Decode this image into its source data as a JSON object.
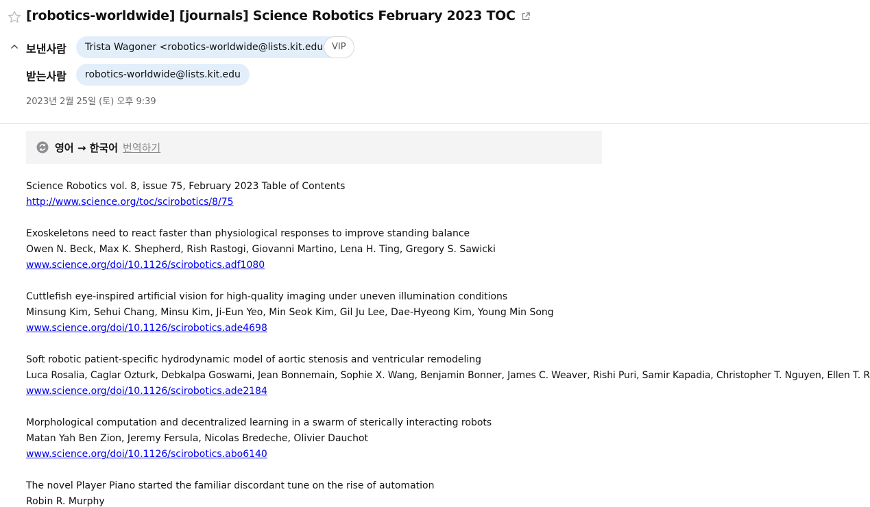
{
  "header": {
    "subject": "[robotics-worldwide] [journals] Science Robotics February 2023 TOC",
    "from_label": "보낸사람",
    "from_value": "Trista Wagoner <robotics-worldwide@lists.kit.edu>",
    "vip_label": "VIP",
    "to_label": "받는사람",
    "to_value": "robotics-worldwide@lists.kit.edu",
    "date": "2023년 2월 25일 (토) 오후 9:39",
    "icons": {
      "star": "star-icon",
      "external": "external-link-icon",
      "collapse": "chevron-up-icon"
    }
  },
  "translate": {
    "langs": "영어 → 한국어",
    "action": "번역하기",
    "icon": "translate-icon"
  },
  "body": {
    "intro_title": "Science Robotics vol. 8, issue 75, February 2023 Table of Contents",
    "intro_link": "http://www.science.org/toc/scirobotics/8/75",
    "articles": [
      {
        "title": "Exoskeletons need to react faster than physiological responses to improve standing balance",
        "authors": "Owen N. Beck, Max K. Shepherd, Rish Rastogi, Giovanni Martino, Lena H. Ting, Gregory S. Sawicki",
        "link": "www.science.org/doi/10.1126/scirobotics.adf1080"
      },
      {
        "title": "Cuttlefish eye-inspired artificial vision for high-quality imaging under uneven illumination conditions",
        "authors": "Minsung Kim, Sehui Chang, Minsu Kim, Ji-Eun Yeo, Min Seok Kim, Gil Ju Lee, Dae-Hyeong Kim, Young Min Song",
        "link": "www.science.org/doi/10.1126/scirobotics.ade4698"
      },
      {
        "title": "Soft robotic patient-specific hydrodynamic model of aortic stenosis and ventricular remodeling",
        "authors": "Luca Rosalia, Caglar Ozturk, Debkalpa Goswami, Jean Bonnemain, Sophie X. Wang, Benjamin Bonner, James C. Weaver, Rishi Puri, Samir Kapadia, Christopher T. Nguyen, Ellen T. Roche",
        "link": "www.science.org/doi/10.1126/scirobotics.ade2184"
      },
      {
        "title": "Morphological computation and decentralized learning in a swarm of sterically interacting robots",
        "authors": "Matan Yah Ben Zion, Jeremy Fersula, Nicolas Bredeche, Olivier Dauchot",
        "link": "www.science.org/doi/10.1126/scirobotics.abo6140"
      },
      {
        "title": "The novel Player Piano started the familiar discordant tune on the rise of automation",
        "authors": "Robin R. Murphy",
        "link": ""
      }
    ]
  }
}
